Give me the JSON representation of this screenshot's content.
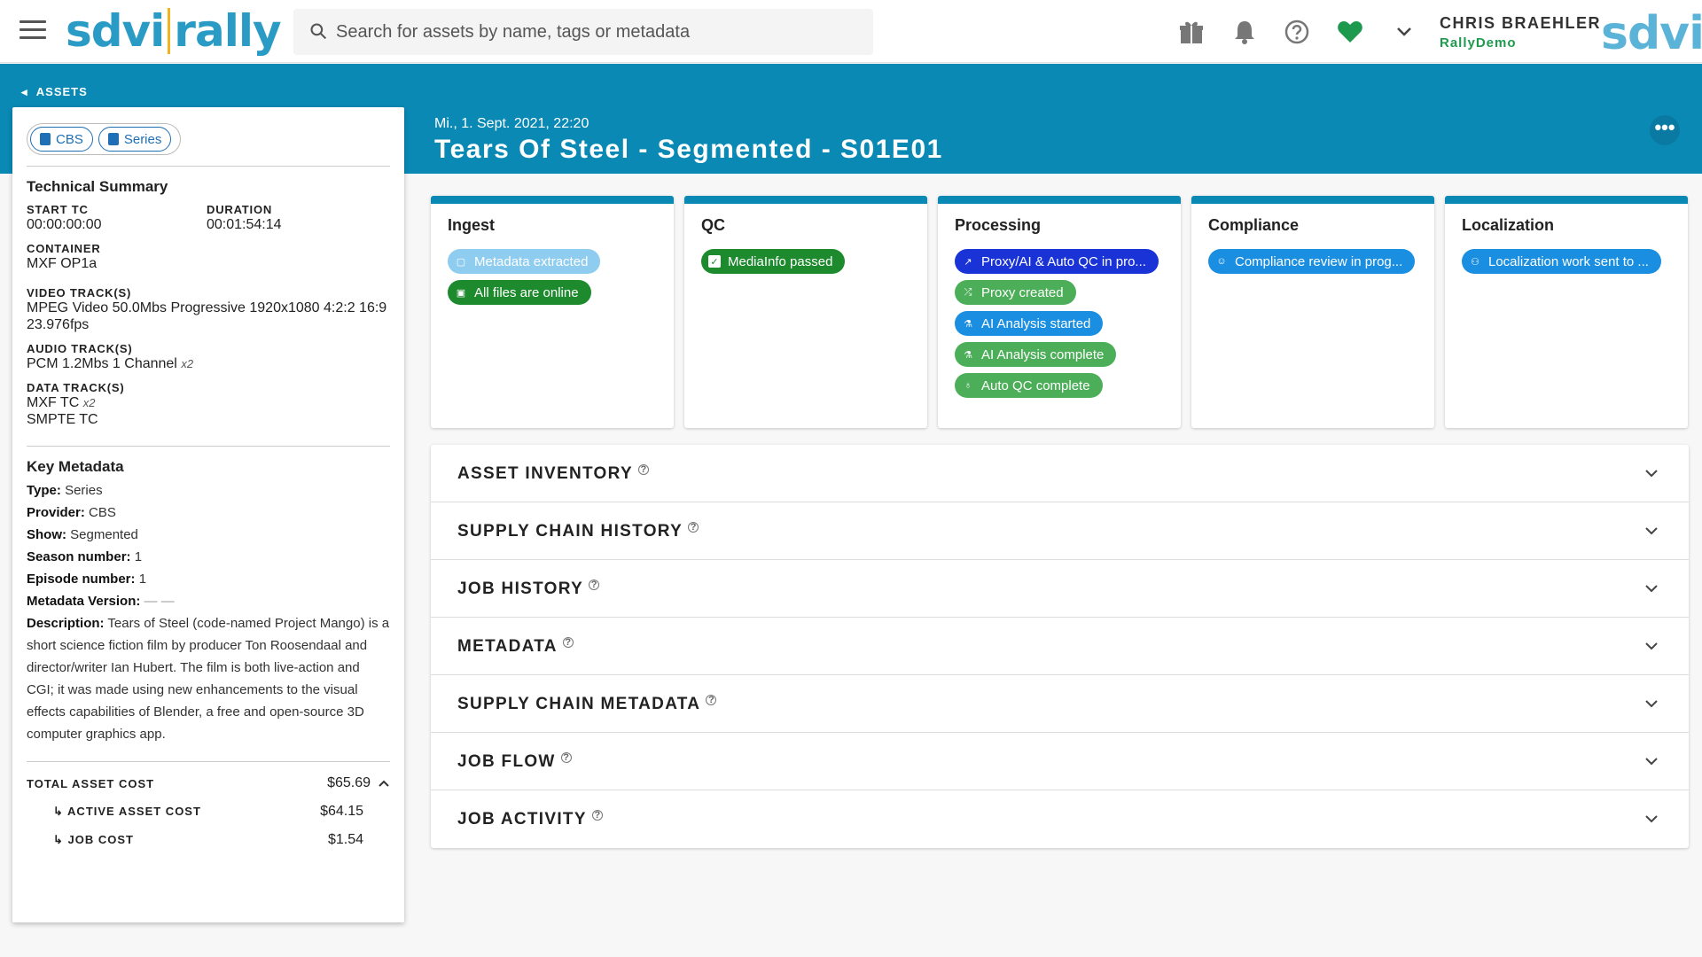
{
  "topbar": {
    "logo_left": "sdvi",
    "logo_right": "rally",
    "search_placeholder": "Search for assets by name, tags or metadata",
    "user_name": "CHRIS BRAEHLER",
    "user_org": "RallyDemo",
    "brand": "sdvi",
    "icons": [
      "menu-icon",
      "search-icon",
      "gift-icon",
      "bell-icon",
      "help-icon",
      "heart-icon",
      "chevron-down-icon"
    ],
    "heart_color": "#1e9a4e"
  },
  "header": {
    "back_label": "ASSETS",
    "date": "Mi., 1. Sept. 2021, 22:20",
    "title": "Tears Of Steel - Segmented - S01E01",
    "more_label": "•••",
    "background": "#0a89b5"
  },
  "panel": {
    "chips": [
      "CBS",
      "Series"
    ],
    "technical_summary": {
      "title": "Technical Summary",
      "start_tc_label": "START TC",
      "start_tc": "00:00:00:00",
      "duration_label": "DURATION",
      "duration": "00:01:54:14",
      "container_label": "CONTAINER",
      "container": "MXF OP1a",
      "video_label": "VIDEO TRACK(S)",
      "video": "MPEG Video 50.0Mbs Progressive 1920x1080 4:2:2 16:9 23.976fps",
      "audio_label": "AUDIO TRACK(S)",
      "audio": "PCM 1.2Mbs 1 Channel",
      "audio_mult": "x2",
      "data_label": "DATA TRACK(S)",
      "data_1": "MXF TC",
      "data_1_mult": "x2",
      "data_2": "SMPTE TC"
    },
    "key_metadata": {
      "title": "Key Metadata",
      "type_label": "Type:",
      "type": "Series",
      "provider_label": "Provider:",
      "provider": "CBS",
      "show_label": "Show:",
      "show": "Segmented",
      "season_label": "Season number:",
      "season": "1",
      "episode_label": "Episode number:",
      "episode": "1",
      "version_label": "Metadata Version:",
      "version": "— —",
      "description_label": "Description:",
      "description": "Tears of Steel (code-named Project Mango) is a short science fiction film by producer Ton Roosendaal and director/writer Ian Hubert. The film is both live-action and CGI; it was made using new enhancements to the visual effects capabilities of Blender, a free and open-source 3D computer graphics app."
    },
    "cost": {
      "total_label": "TOTAL ASSET COST",
      "total": "$65.69",
      "active_label": "ACTIVE ASSET COST",
      "active": "$64.15",
      "job_label": "JOB COST",
      "job": "$1.54"
    }
  },
  "cards": [
    {
      "title": "Ingest",
      "pills": [
        {
          "label": "Metadata extracted",
          "color": "#8ecdf0",
          "icon": "comment-icon"
        },
        {
          "label": "All files are online",
          "color": "#1e8a2e",
          "icon": "images-icon"
        }
      ]
    },
    {
      "title": "QC",
      "pills": [
        {
          "label": "MediaInfo passed",
          "color": "#1e8a2e",
          "icon": "check-box-icon"
        }
      ]
    },
    {
      "title": "Processing",
      "pills": [
        {
          "label": "Proxy/AI & Auto QC in pro...",
          "color": "#1a33d6",
          "icon": "compress-icon"
        },
        {
          "label": "Proxy created",
          "color": "#4cae58",
          "icon": "shuffle-icon"
        },
        {
          "label": "AI Analysis started",
          "color": "#1a8ee0",
          "icon": "microscope-icon"
        },
        {
          "label": "AI Analysis complete",
          "color": "#4cae58",
          "icon": "microscope-icon"
        },
        {
          "label": "Auto QC complete",
          "color": "#4cae58",
          "icon": "stethoscope-icon"
        }
      ]
    },
    {
      "title": "Compliance",
      "pills": [
        {
          "label": "Compliance review in prog...",
          "color": "#1a8ee0",
          "icon": "user-check-icon"
        }
      ]
    },
    {
      "title": "Localization",
      "pills": [
        {
          "label": "Localization work sent to ...",
          "color": "#1a8ee0",
          "icon": "people-icon"
        }
      ]
    }
  ],
  "accordions": [
    "ASSET INVENTORY",
    "SUPPLY CHAIN HISTORY",
    "JOB HISTORY",
    "METADATA",
    "SUPPLY CHAIN METADATA",
    "JOB FLOW",
    "JOB ACTIVITY"
  ],
  "help_mark": "?"
}
